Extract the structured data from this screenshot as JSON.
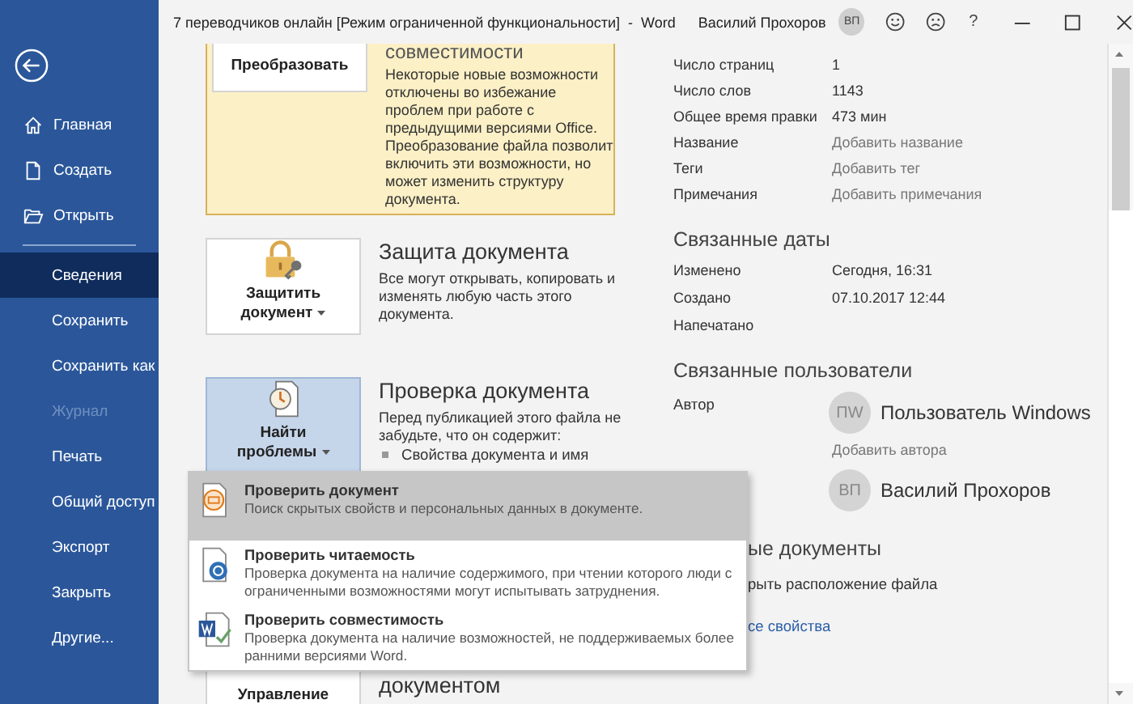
{
  "window": {
    "title": "7 переводчиков онлайн [Режим ограниченной функциональности]  -  Word",
    "user": "Василий Прохоров",
    "user_initials": "ВП",
    "help": "?"
  },
  "sidebar": {
    "items": [
      {
        "label": "Главная",
        "kind": "home",
        "selected": false,
        "disabled": false
      },
      {
        "label": "Создать",
        "kind": "new",
        "selected": false,
        "disabled": false
      },
      {
        "label": "Открыть",
        "kind": "open",
        "selected": false,
        "disabled": false
      },
      {
        "label": "Сведения",
        "kind": "plain",
        "selected": true,
        "disabled": false
      },
      {
        "label": "Сохранить",
        "kind": "plain",
        "selected": false,
        "disabled": false
      },
      {
        "label": "Сохранить как",
        "kind": "plain",
        "selected": false,
        "disabled": false
      },
      {
        "label": "Журнал",
        "kind": "plain",
        "selected": false,
        "disabled": true
      },
      {
        "label": "Печать",
        "kind": "plain",
        "selected": false,
        "disabled": false
      },
      {
        "label": "Общий доступ",
        "kind": "plain",
        "selected": false,
        "disabled": false
      },
      {
        "label": "Экспорт",
        "kind": "plain",
        "selected": false,
        "disabled": false
      },
      {
        "label": "Закрыть",
        "kind": "plain",
        "selected": false,
        "disabled": false
      },
      {
        "label": "Другие...",
        "kind": "plain",
        "selected": false,
        "disabled": false
      }
    ]
  },
  "sections": [
    {
      "kind": "compat",
      "button_lines": [
        "Преобразовать"
      ],
      "heading": "совместимости",
      "text": "Некоторые новые возможности отключены во избежание проблем при работе с предыдущими версиями Office. Преобразование файла позволит включить эти возможности, но может изменить структуру документа."
    },
    {
      "kind": "protect",
      "button_lines": [
        "Защитить",
        "документ"
      ],
      "has_menu": true,
      "heading": "Защита документа",
      "text": "Все могут открывать, копировать и изменять любую часть этого документа."
    },
    {
      "kind": "inspect",
      "button_lines": [
        "Найти",
        "проблемы"
      ],
      "has_menu": true,
      "menu_open": true,
      "heading": "Проверка документа",
      "text": "Перед публикацией этого файла не забудьте, что он содержит:",
      "bullets": [
        "Свойства документа и имя"
      ]
    },
    {
      "kind": "manage",
      "button_lines": [
        "Управление"
      ],
      "heading": "документом"
    }
  ],
  "menu": {
    "items": [
      {
        "kind": "inspect",
        "title": "Проверить документ",
        "description": "Поиск скрытых свойств и персональных данных в документе.",
        "selected": true
      },
      {
        "kind": "accessibility",
        "title": "Проверить читаемость",
        "description": "Проверка документа на наличие содержимого, при чтении которого люди с ограниченными возможностями могут испытывать затруднения.",
        "selected": false
      },
      {
        "kind": "compatibility",
        "title": "Проверить совместимость",
        "description": "Проверка документа на наличие возможностей, не поддерживаемых более ранними версиями Word.",
        "selected": false
      }
    ]
  },
  "properties": {
    "rows": [
      {
        "label": "Число страниц",
        "value": "1",
        "kind": "value"
      },
      {
        "label": "Число слов",
        "value": "1143",
        "kind": "value"
      },
      {
        "label": "Общее время правки",
        "value": "473 мин",
        "kind": "value"
      },
      {
        "label": "Название",
        "value": "Добавить название",
        "kind": "add"
      },
      {
        "label": "Теги",
        "value": "Добавить тег",
        "kind": "add"
      },
      {
        "label": "Примечания",
        "value": "Добавить примечания",
        "kind": "add"
      }
    ]
  },
  "related_dates": {
    "heading": "Связанные даты",
    "rows": [
      {
        "label": "Изменено",
        "value": "Сегодня, 16:31"
      },
      {
        "label": "Создано",
        "value": "07.10.2017 12:44"
      },
      {
        "label": "Напечатано"
      }
    ]
  },
  "related_people": {
    "heading": "Связанные пользователи",
    "people": [
      {
        "label": "Автор",
        "initials": "ПW",
        "name": "Пользователь Windows",
        "add": "Добавить автора"
      },
      {
        "initials": "ВП",
        "name": "Василий Прохоров"
      }
    ]
  },
  "related_documents": {
    "heading": "ые документы",
    "items": [
      {
        "text": "рыть расположение файла",
        "kind": "value"
      },
      {
        "text": "се свойства",
        "kind": "link"
      }
    ]
  }
}
